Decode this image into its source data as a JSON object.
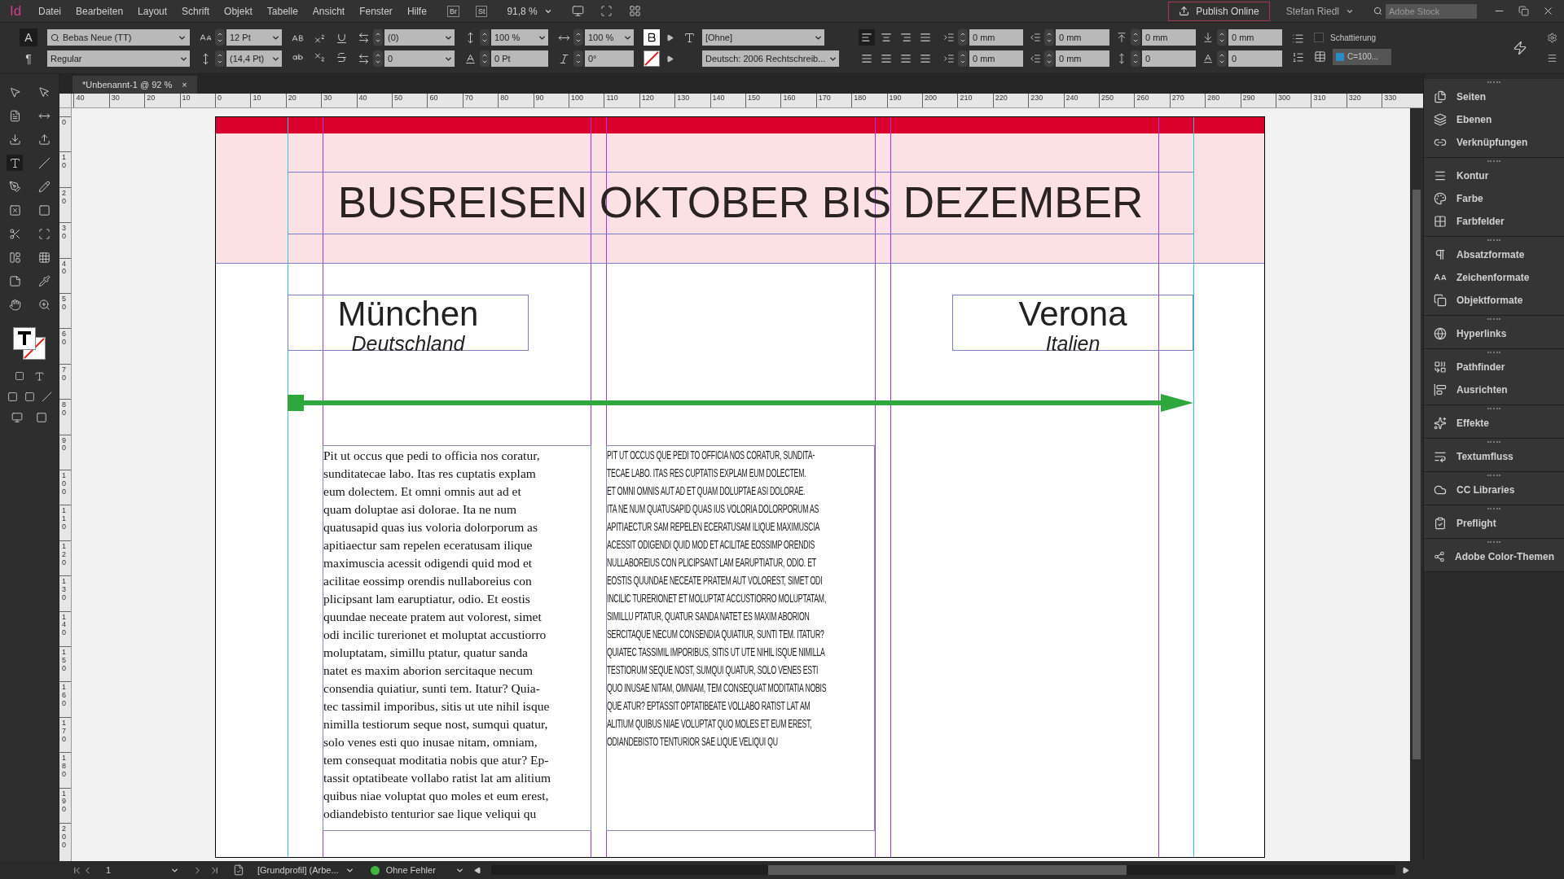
{
  "app": {
    "logo": "Id"
  },
  "menu": [
    "Datei",
    "Bearbeiten",
    "Layout",
    "Schrift",
    "Objekt",
    "Tabelle",
    "Ansicht",
    "Fenster",
    "Hilfe"
  ],
  "appbar": {
    "bridge": "Br",
    "stock": "St",
    "zoom": "91,8 %",
    "publish": "Publish Online",
    "user": "Stefan Riedl",
    "search_placeholder": "Adobe Stock"
  },
  "control": {
    "modes": [
      {
        "label": "A",
        "selected": true
      },
      {
        "label": "¶",
        "selected": false
      }
    ],
    "font": "Bebas Neue (TT)",
    "style": "Regular",
    "size": "12 Pt",
    "leading": "(14,4 Pt)",
    "kerning": "(0)",
    "tracking": "0",
    "vertical_scale": "100 %",
    "baseline_shift": "0 Pt",
    "horizontal_scale": "100 %",
    "skew": "0°",
    "char_style": "[Ohne]",
    "language": "Deutsch: 2006 Rechtschreib...",
    "alignment": [
      {
        "selected": true
      },
      {
        "selected": false
      },
      {
        "selected": false
      },
      {
        "selected": false
      },
      {
        "selected": false
      },
      {
        "selected": false
      },
      {
        "selected": false
      },
      {
        "selected": false
      }
    ],
    "paragraph_fields": [
      "0 mm",
      "0 mm",
      "0 mm",
      "0 mm",
      "0 mm",
      "0 mm",
      "0",
      "0"
    ],
    "shading": {
      "label": "Schattierung",
      "checked": false
    },
    "swatch": "C=100..."
  },
  "tab": {
    "title": "*Unbenannt-1 @ 92 %",
    "close": "×"
  },
  "ruler": {
    "h": [
      "40",
      "30",
      "20",
      "10",
      "0",
      "10",
      "20",
      "30",
      "40",
      "50",
      "60",
      "70",
      "80",
      "90",
      "100",
      "110",
      "120",
      "130",
      "140",
      "150",
      "160",
      "170",
      "180",
      "190",
      "200",
      "210",
      "220",
      "230",
      "240",
      "250",
      "260",
      "270",
      "280",
      "290",
      "300",
      "310",
      "320",
      "330"
    ],
    "v": [
      "0",
      "10",
      "20",
      "30",
      "40",
      "50",
      "60",
      "70",
      "80",
      "90",
      "100",
      "110",
      "120",
      "130",
      "140",
      "150",
      "160",
      "170",
      "180",
      "190",
      "200"
    ]
  },
  "page": {
    "title": "BUSREISEN OKTOBER BIS DEZEMBER",
    "origin": {
      "city": "München",
      "country": "Deutschland"
    },
    "destination": {
      "city": "Verona",
      "country": "Italien"
    },
    "columns": [
      {
        "kind": "serif",
        "text": "Pit ut occus que pedi to officia nos coratur,\nsunditatecae labo. Itas res cuptatis explam\neum dolectem. Et omni omnis aut ad et\nquam doluptae asi dolorae. Ita ne num\nquatusapid quas ius voloria dolorporum as\napitiaectur sam repelen eceratusam ilique\nmaximuscia acessit odigendi quid mod et\nacilitae eossimp orendis nullaboreius con\nplicipsant lam earuptiatur, odio. Et eostis\nquundae neceate pratem aut volorest, simet\nodi incilic turerionet et moluptat accustiorro\nmoluptatam, simillu ptatur, quatur sanda\nnatet es maxim aborion sercitaque necum\nconsendia quiatiur, sunti tem. Itatur? Quia-\ntec tassimil imporibus, sitis ut ute nihil isque\nnimilla testiorum seque nost, sumqui quatur,\nsolo venes esti quo inusae nitam, omniam,\ntem consequat moditatia nobis que atur? Ep-\ntassit optatibeate vollabo ratist lat am alitium\nquibus niae voluptat quo moles et eum erest,\nodiandebisto tenturior sae lique veliqui qu"
      },
      {
        "kind": "caps",
        "text": "PIT UT OCCUS QUE PEDI TO OFFICIA NOS CORATUR, SUNDITA-\nTECAE LABO. ITAS RES CUPTATIS EXPLAM EUM DOLECTEM.\nET OMNI OMNIS AUT AD ET QUAM DOLUPTAE ASI DOLORAE.\nITA NE NUM QUATUSAPID QUAS IUS VOLORIA DOLORPORUM AS\nAPITIAECTUR SAM REPELEN ECERATUSAM ILIQUE MAXIMUSCIA\nACESSIT ODIGENDI QUID MOD ET ACILITAE EOSSIMP ORENDIS\nNULLABOREIUS CON PLICIPSANT LAM EARUPTIATUR, ODIO. ET\nEOSTIS QUUNDAE NECEATE PRATEM AUT VOLOREST, SIMET ODI\nINCILIC TURERIONET ET MOLUPTAT ACCUSTIORRO MOLUPTATAM,\nSIMILLU PTATUR, QUATUR SANDA NATET ES MAXIM ABORION\nSERCITAQUE NECUM CONSENDIA QUIATIUR, SUNTI TEM. ITATUR?\nQUIATEC TASSIMIL IMPORIBUS, SITIS UT UTE NIHIL ISQUE NIMILLA\nTESTIORUM SEQUE NOST, SUMQUI QUATUR, SOLO VENES ESTI\nQUO INUSAE NITAM, OMNIAM, TEM CONSEQUAT MODITATIA NOBIS\nQUE ATUR? EPTASSIT OPTATIBEATE VOLLABO RATIST LAT AM\nALITIUM QUIBUS NIAE VOLUPTAT QUO MOLES ET EUM EREST,\nODIANDEBISTO TENTURIOR SAE LIQUE VELIQUI QU"
      }
    ]
  },
  "panels": [
    [
      {
        "label": "Seiten"
      },
      {
        "label": "Ebenen"
      },
      {
        "label": "Verknüpfungen"
      }
    ],
    [
      {
        "label": "Kontur"
      },
      {
        "label": "Farbe"
      },
      {
        "label": "Farbfelder"
      }
    ],
    [
      {
        "label": "Absatzformate"
      },
      {
        "label": "Zeichenformate"
      },
      {
        "label": "Objektformate"
      }
    ],
    [
      {
        "label": "Hyperlinks"
      }
    ],
    [
      {
        "label": "Pathfinder"
      },
      {
        "label": "Ausrichten"
      }
    ],
    [
      {
        "label": "Effekte"
      }
    ],
    [
      {
        "label": "Textumfluss"
      }
    ],
    [
      {
        "label": "CC Libraries"
      }
    ],
    [
      {
        "label": "Preflight"
      }
    ],
    [
      {
        "label": "Adobe Color-Themen"
      }
    ]
  ],
  "status": {
    "page": "1",
    "profile": "[Grundprofil] (Arbe...",
    "preflight": "Ohne Fehler",
    "ok": true
  }
}
